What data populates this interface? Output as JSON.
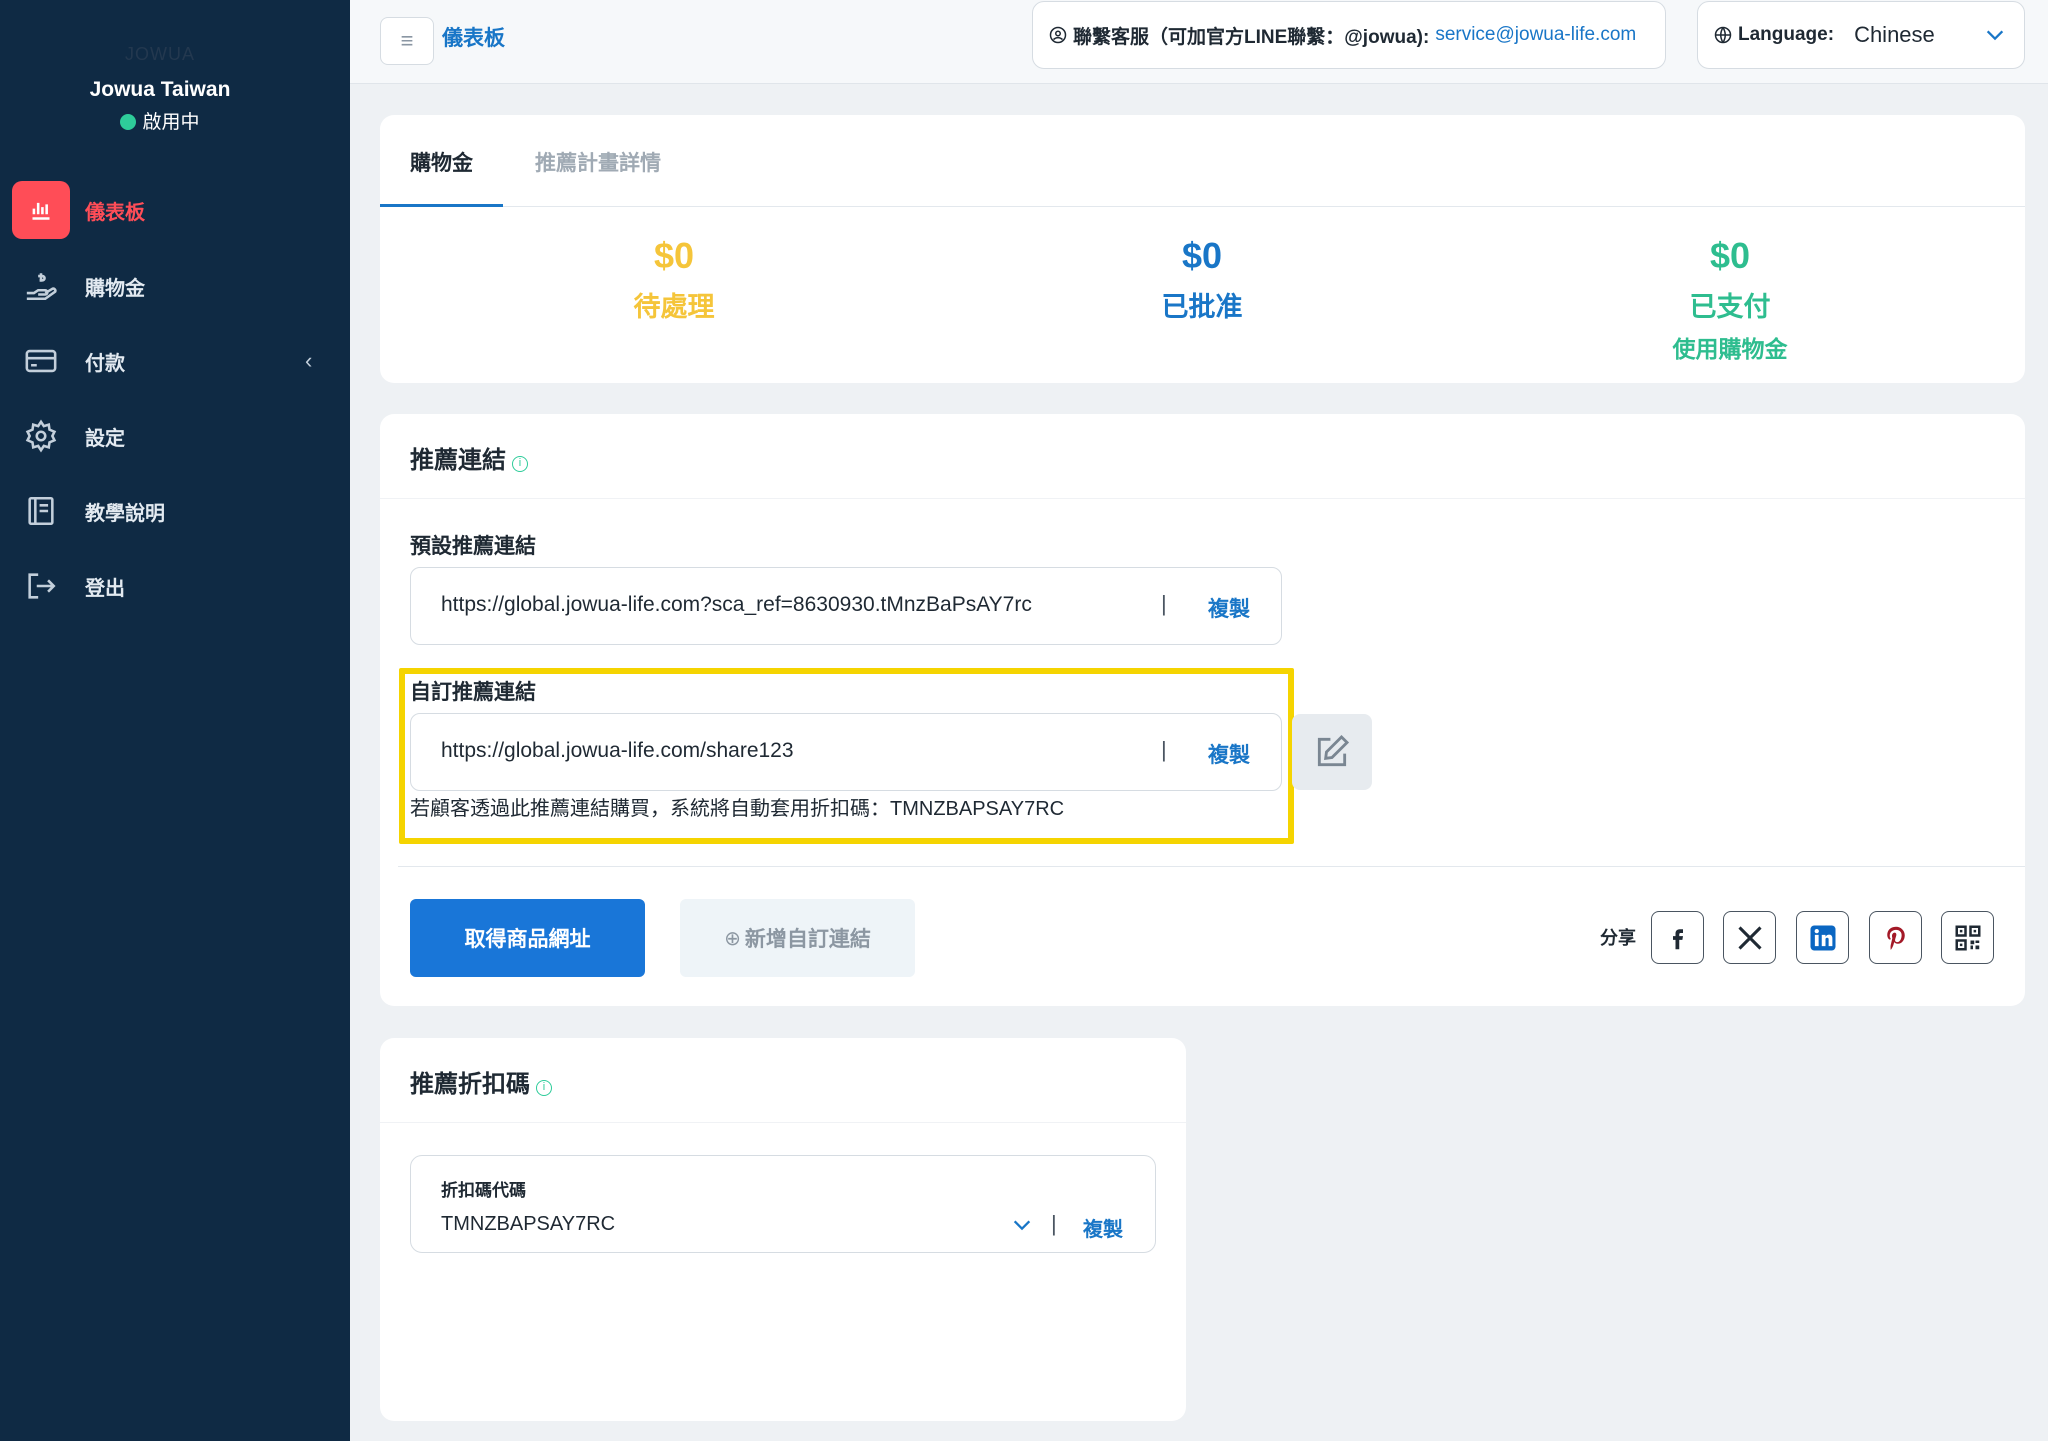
{
  "brand": {
    "logo_text": "JOWUA",
    "name": "Jowua Taiwan",
    "status": "啟用中"
  },
  "sidebar": {
    "items": [
      {
        "label": "儀表板"
      },
      {
        "label": "購物金"
      },
      {
        "label": "付款"
      },
      {
        "label": "設定"
      },
      {
        "label": "教學說明"
      },
      {
        "label": "登出"
      }
    ]
  },
  "header": {
    "title": "儀表板",
    "support_label": "聯繫客服（可加官方LINE聯繫：@jowua):",
    "support_email": "service@jowua-life.com",
    "language_label": "Language:",
    "language_value": "Chinese"
  },
  "credits": {
    "tabs": [
      "購物金",
      "推薦計畫詳情"
    ],
    "stats": [
      {
        "amount": "$0",
        "label": "待處理",
        "color": "#f5c53a"
      },
      {
        "amount": "$0",
        "label": "已批准",
        "color": "#1976c7"
      },
      {
        "amount": "$0",
        "label": "已支付",
        "sub": "使用購物金",
        "color": "#2ebd8f"
      }
    ]
  },
  "referral_link": {
    "title": "推薦連結",
    "default_label": "預設推薦連結",
    "default_url": "https://global.jowua-life.com?sca_ref=8630930.tMnzBaPsAY7rc",
    "custom_label": "自訂推薦連結",
    "custom_url": "https://global.jowua-life.com/share123",
    "copy_label": "複製",
    "hint": "若顧客透過此推薦連結購買，系統將自動套用折扣碼：TMNZBAPSAY7RC",
    "get_product_url": "取得商品網址",
    "add_custom_link": "新增自訂連結",
    "share_label": "分享",
    "share_targets": [
      "facebook",
      "x",
      "linkedin",
      "pinterest",
      "qr-code"
    ]
  },
  "discount": {
    "title": "推薦折扣碼",
    "code_label": "折扣碼代碼",
    "code_value": "TMNZBAPSAY7RC",
    "copy_label": "複製"
  },
  "colors": {
    "sidebar_bg": "#0f2a44",
    "accent": "#1976d8",
    "active_red": "#ff4d57",
    "highlight": "#f5d400"
  }
}
